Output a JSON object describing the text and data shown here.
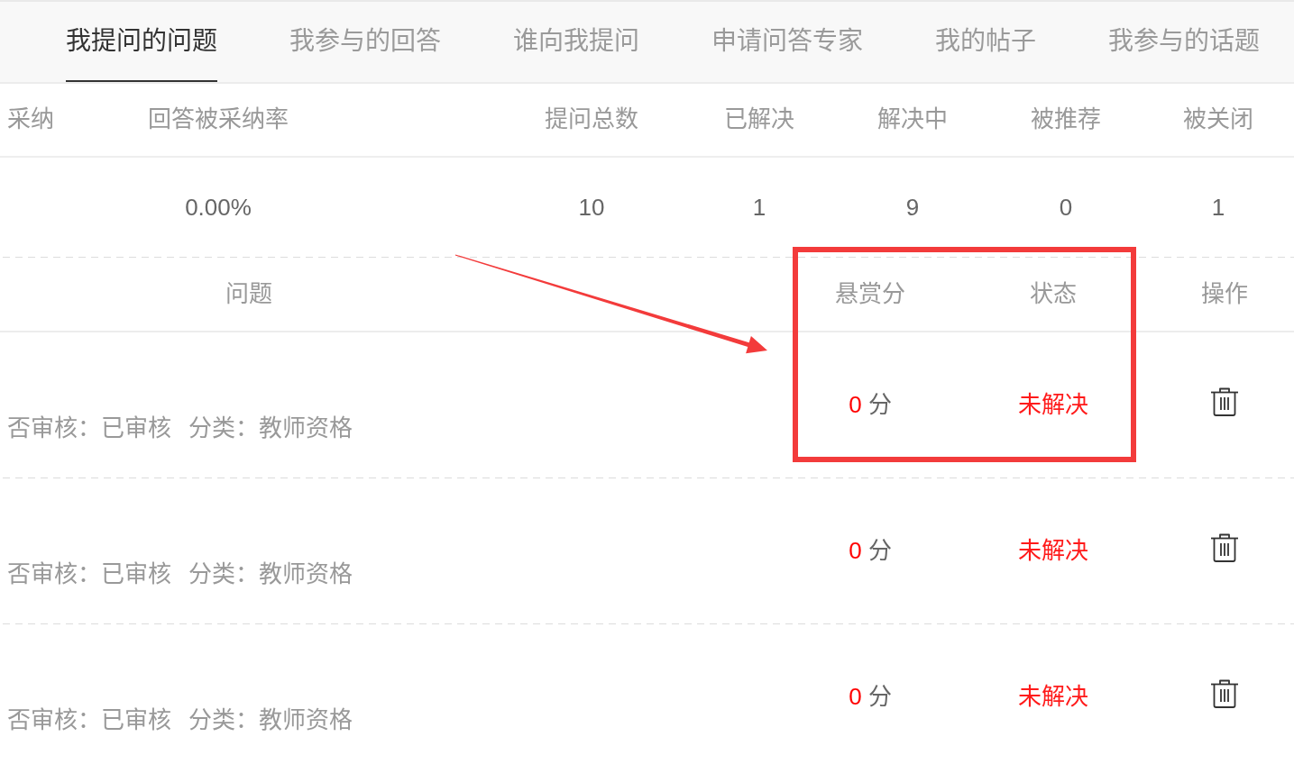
{
  "tabs": [
    {
      "label": "我提问的问题",
      "selected": true
    },
    {
      "label": "我参与的回答",
      "selected": false
    },
    {
      "label": "谁向我提问",
      "selected": false
    },
    {
      "label": "申请问答专家",
      "selected": false
    },
    {
      "label": "我的帖子",
      "selected": false
    },
    {
      "label": "我参与的话题",
      "selected": false
    }
  ],
  "stats": [
    {
      "label": "采纳"
    },
    {
      "label": "回答被采纳率",
      "value": "0.00%"
    },
    {
      "label": "提问总数",
      "value": "10"
    },
    {
      "label": "已解决",
      "value": "1"
    },
    {
      "label": "解决中",
      "value": "9"
    },
    {
      "label": "被推荐",
      "value": "0"
    },
    {
      "label": "被关闭",
      "value": "1"
    }
  ],
  "question_table": {
    "columns": [
      "问题",
      "悬赏分",
      "状态",
      "操作"
    ],
    "rows": [
      {
        "review": "否审核：已审核",
        "category": "分类：教师资格",
        "reward": "0",
        "reward_unit": "分",
        "status": "未解决"
      },
      {
        "review": "否审核：已审核",
        "category": "分类：教师资格",
        "reward": "0",
        "reward_unit": "分",
        "status": "未解决"
      },
      {
        "review": "否审核：已审核",
        "category": "分类：教师资格",
        "reward": "0",
        "reward_unit": "分",
        "status": "未解决"
      }
    ]
  },
  "annotations": {
    "highlight_frame": true,
    "arrow": true
  }
}
